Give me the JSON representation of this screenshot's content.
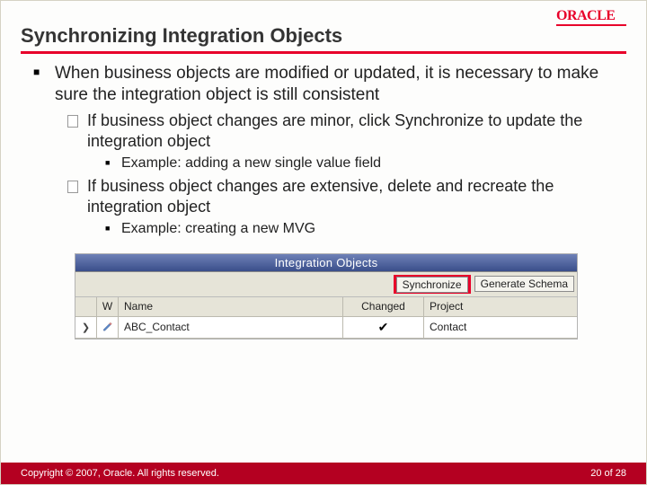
{
  "header": {
    "logo_text": "ORACLE",
    "title": "Synchronizing Integration Objects"
  },
  "body": {
    "p1": "When business objects are modified or updated, it is necessary to make sure the integration object is still consistent",
    "p1a": "If business object changes are minor, click Synchronize to update the integration object",
    "p1a_ex": "Example: adding a new single value field",
    "p1b": "If business object changes are extensive, delete and recreate the integration object",
    "p1b_ex": "Example: creating a new MVG"
  },
  "io_panel": {
    "title": "Integration Objects",
    "sync_btn": "Synchronize",
    "gen_btn": "Generate Schema",
    "cols": {
      "w": "W",
      "name": "Name",
      "changed": "Changed",
      "project": "Project"
    },
    "row": {
      "name": "ABC_Contact",
      "changed": "✔",
      "project": "Contact"
    }
  },
  "footer": {
    "copyright": "Copyright © 2007, Oracle. All rights reserved.",
    "page_current": "20",
    "page_sep": " of ",
    "page_total": "28"
  }
}
